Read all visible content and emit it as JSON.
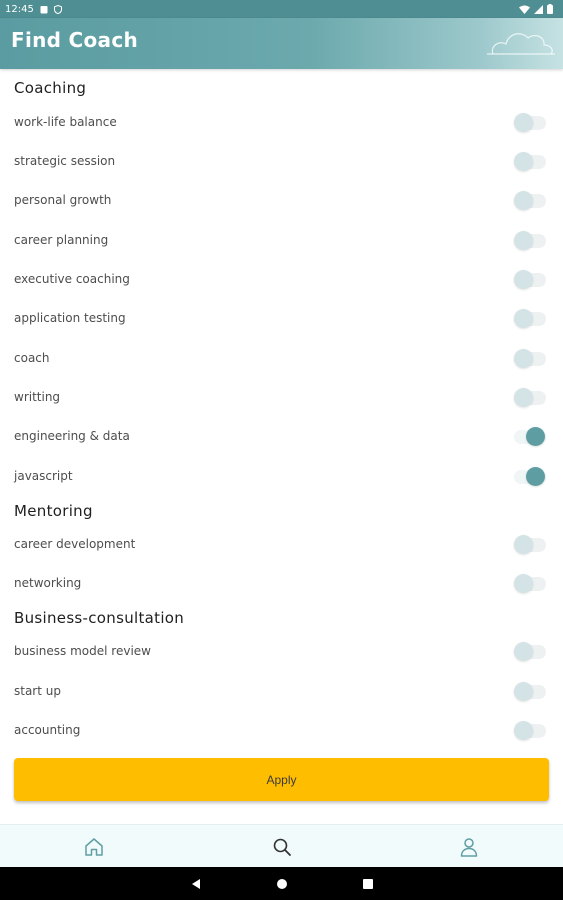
{
  "status_bar": {
    "time": "12:45"
  },
  "app_bar": {
    "title": "Find Coach"
  },
  "sections": [
    {
      "title": "Coaching",
      "items": [
        {
          "label": "work-life balance",
          "on": false
        },
        {
          "label": "strategic session",
          "on": false
        },
        {
          "label": "personal growth",
          "on": false
        },
        {
          "label": "career planning",
          "on": false
        },
        {
          "label": "executive coaching",
          "on": false
        },
        {
          "label": "application testing",
          "on": false
        },
        {
          "label": "coach",
          "on": false
        },
        {
          "label": "writting",
          "on": false
        },
        {
          "label": "engineering & data",
          "on": true
        },
        {
          "label": "javascript",
          "on": true
        }
      ]
    },
    {
      "title": "Mentoring",
      "items": [
        {
          "label": "career development",
          "on": false
        },
        {
          "label": "networking",
          "on": false
        }
      ]
    },
    {
      "title": "Business-consultation",
      "items": [
        {
          "label": "business model review",
          "on": false
        },
        {
          "label": "start up",
          "on": false
        },
        {
          "label": "accounting",
          "on": false
        }
      ]
    }
  ],
  "apply_label": "Apply",
  "bottom_nav": {
    "items": [
      {
        "name": "home-icon"
      },
      {
        "name": "search-icon"
      },
      {
        "name": "profile-icon"
      }
    ]
  },
  "colors": {
    "accent": "#5e9ea3",
    "app_bar": "#5a9ca1",
    "apply": "#ffbd00"
  }
}
